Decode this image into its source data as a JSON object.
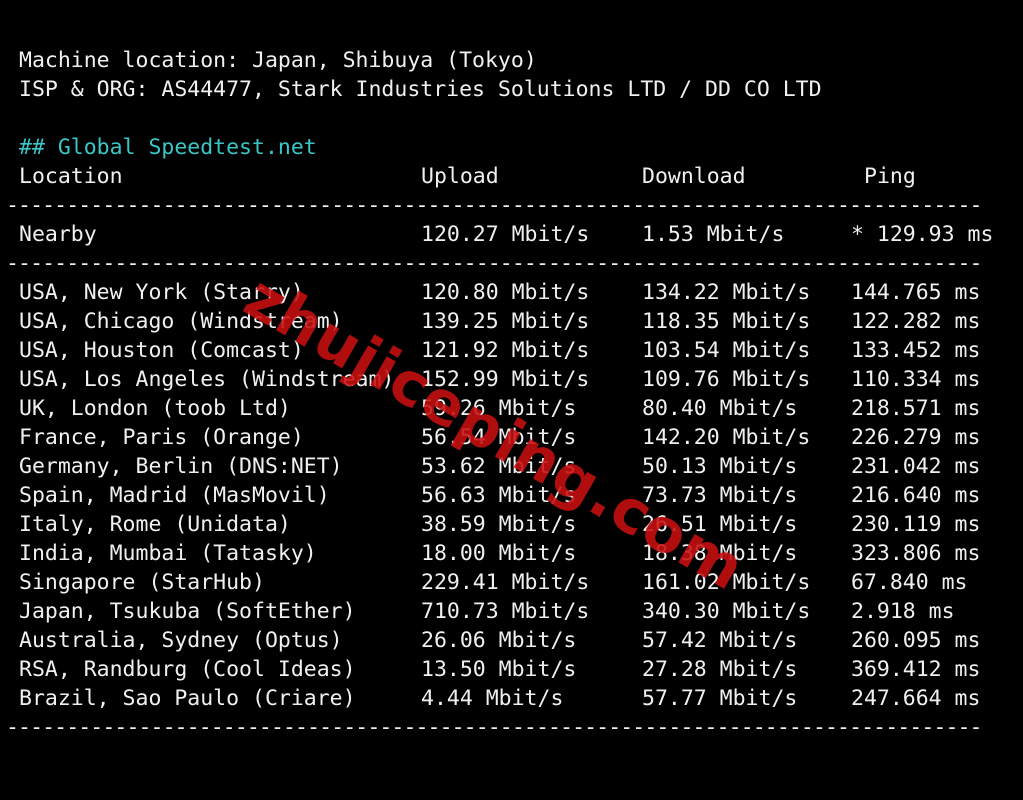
{
  "machine_location": "Machine location: Japan, Shibuya (Tokyo)",
  "isp_org": "ISP & ORG: AS44477, Stark Industries Solutions LTD / DD CO LTD",
  "section_heading": "## Global Speedtest.net",
  "table": {
    "headers": {
      "location": "Location",
      "upload": "Upload",
      "download": "Download",
      "ping": "Ping"
    },
    "separator": "------------------------------------------------------------------------------------------------------------------------",
    "nearby": {
      "location": "Nearby",
      "upload": "120.27 Mbit/s",
      "download": "1.53 Mbit/s",
      "ping": "* 129.93 ms"
    },
    "rows": [
      {
        "location": "USA, New York (Starry)",
        "upload": "120.80 Mbit/s",
        "download": "134.22 Mbit/s",
        "ping": "144.765 ms"
      },
      {
        "location": "USA, Chicago (Windstream)",
        "upload": "139.25 Mbit/s",
        "download": "118.35 Mbit/s",
        "ping": "122.282 ms"
      },
      {
        "location": "USA, Houston (Comcast)",
        "upload": "121.92 Mbit/s",
        "download": "103.54 Mbit/s",
        "ping": "133.452 ms"
      },
      {
        "location": "USA, Los Angeles (Windstream)",
        "upload": "152.99 Mbit/s",
        "download": "109.76 Mbit/s",
        "ping": "110.334 ms"
      },
      {
        "location": "UK, London (toob Ltd)",
        "upload": "59.26 Mbit/s",
        "download": "80.40 Mbit/s",
        "ping": "218.571 ms"
      },
      {
        "location": "France, Paris (Orange)",
        "upload": "56.54 Mbit/s",
        "download": "142.20 Mbit/s",
        "ping": "226.279 ms"
      },
      {
        "location": "Germany, Berlin (DNS:NET)",
        "upload": "53.62 Mbit/s",
        "download": "50.13 Mbit/s",
        "ping": "231.042 ms"
      },
      {
        "location": "Spain, Madrid (MasMovil)",
        "upload": "56.63 Mbit/s",
        "download": "73.73 Mbit/s",
        "ping": "216.640 ms"
      },
      {
        "location": "Italy, Rome (Unidata)",
        "upload": "38.59 Mbit/s",
        "download": "26.51 Mbit/s",
        "ping": "230.119 ms"
      },
      {
        "location": "India, Mumbai (Tatasky)",
        "upload": "18.00 Mbit/s",
        "download": "18.38 Mbit/s",
        "ping": "323.806 ms"
      },
      {
        "location": "Singapore (StarHub)",
        "upload": "229.41 Mbit/s",
        "download": "161.02 Mbit/s",
        "ping": "67.840 ms"
      },
      {
        "location": "Japan, Tsukuba (SoftEther)",
        "upload": "710.73 Mbit/s",
        "download": "340.30 Mbit/s",
        "ping": "2.918 ms"
      },
      {
        "location": "Australia, Sydney (Optus)",
        "upload": "26.06 Mbit/s",
        "download": "57.42 Mbit/s",
        "ping": "260.095 ms"
      },
      {
        "location": "RSA, Randburg (Cool Ideas)",
        "upload": "13.50 Mbit/s",
        "download": "27.28 Mbit/s",
        "ping": "369.412 ms"
      },
      {
        "location": "Brazil, Sao Paulo (Criare)",
        "upload": "4.44 Mbit/s",
        "download": "57.77 Mbit/s",
        "ping": "247.664 ms"
      }
    ]
  },
  "watermark": "zhujiceping.com",
  "colors": {
    "background": "#000000",
    "text": "#f0f0f0",
    "heading": "#3ac6c6",
    "watermark": "#c81010"
  }
}
